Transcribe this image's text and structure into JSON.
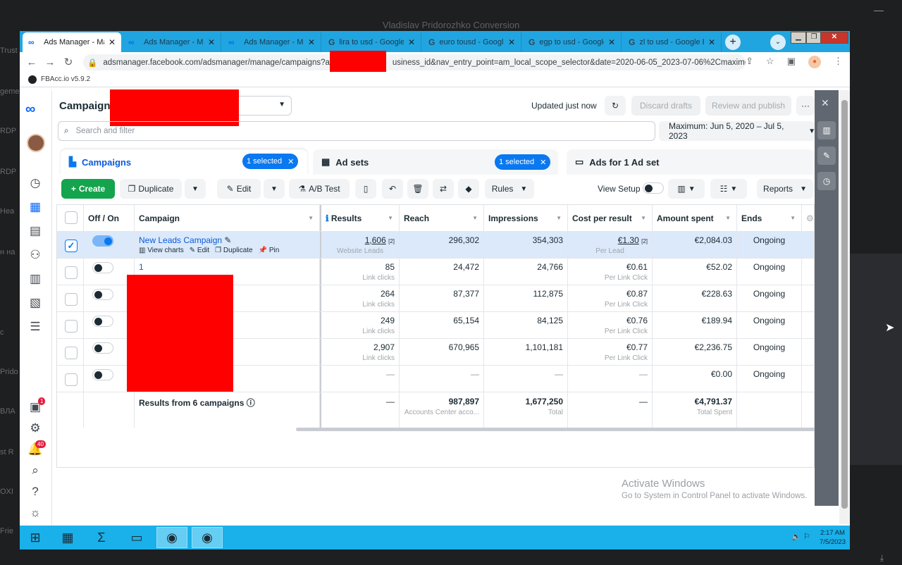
{
  "outer": {
    "title": "Vladislav Pridorozhko Conversion",
    "side_texts": [
      "Trust",
      "geme",
      "RDP",
      "RDP",
      "Hea",
      "н на",
      "c",
      "Prido",
      "ВЛА",
      "st R",
      "OXI",
      "Frie"
    ]
  },
  "browser": {
    "tabs": [
      {
        "label": "Ads Manager - Mar",
        "icon": "meta-icon"
      },
      {
        "label": "Ads Manager - Mar",
        "icon": "meta-icon"
      },
      {
        "label": "Ads Manager - Mar",
        "icon": "meta-icon"
      },
      {
        "label": "lira to usd - Google",
        "icon": "google-icon"
      },
      {
        "label": "euro tousd - Google",
        "icon": "google-icon"
      },
      {
        "label": "egp to usd - Google",
        "icon": "google-icon"
      },
      {
        "label": "zl to usd - Google B",
        "icon": "google-icon"
      }
    ],
    "url": "adsmanager.facebook.com/adsmanager/manage/campaigns?act",
    "url_tail": "usiness_id&nav_entry_point=am_local_scope_selector&date=2020-06-05_2023-07-06%2Cmaximu...",
    "extension": "FBAcc.io v5.9.2"
  },
  "header": {
    "title": "Campaigns",
    "updated": "Updated just now",
    "discard": "Discard drafts",
    "review": "Review and publish",
    "more": "···",
    "search_placeholder": "Search and filter",
    "date_range": "Maximum: Jun 5, 2020 – Jul 5, 2023"
  },
  "level_tabs": {
    "campaigns": "Campaigns",
    "campaigns_chip": "1 selected",
    "adsets": "Ad sets",
    "adsets_chip": "1 selected",
    "ads": "Ads for 1 Ad set"
  },
  "actions": {
    "create": "Create",
    "duplicate": "Duplicate",
    "edit": "Edit",
    "abtest": "A/B Test",
    "rules": "Rules",
    "view_setup": "View Setup",
    "reports": "Reports"
  },
  "table": {
    "columns": {
      "offon": "Off / On",
      "campaign": "Campaign",
      "results": "Results",
      "reach": "Reach",
      "impressions": "Impressions",
      "cpr": "Cost per result",
      "spent": "Amount spent",
      "ends": "Ends"
    },
    "hover_links": {
      "charts": "View charts",
      "edit": "Edit",
      "duplicate": "Duplicate",
      "pin": "Pin"
    },
    "rows": [
      {
        "name": "New Leads Campaign",
        "on": true,
        "selected": true,
        "results": "1,606",
        "results_sub": "Website Leads",
        "reach": "296,302",
        "impressions": "354,303",
        "cpr": "€1.30",
        "cpr_sub": "Per Lead",
        "spent": "€2,084.03",
        "ends": "Ongoing"
      },
      {
        "name": "1",
        "on": false,
        "selected": false,
        "results": "85",
        "results_sub": "Link clicks",
        "reach": "24,472",
        "impressions": "24,766",
        "cpr": "€0.61",
        "cpr_sub": "Per Link Click",
        "spent": "€52.02",
        "ends": "Ongoing"
      },
      {
        "name": "",
        "on": false,
        "selected": false,
        "results": "264",
        "results_sub": "Link clicks",
        "reach": "87,377",
        "impressions": "112,875",
        "cpr": "€0.87",
        "cpr_sub": "Per Link Click",
        "spent": "€228.63",
        "ends": "Ongoing"
      },
      {
        "name": "",
        "on": false,
        "selected": false,
        "results": "249",
        "results_sub": "Link clicks",
        "reach": "65,154",
        "impressions": "84,125",
        "cpr": "€0.76",
        "cpr_sub": "Per Link Click",
        "spent": "€189.94",
        "ends": "Ongoing"
      },
      {
        "name": "",
        "on": false,
        "selected": false,
        "results": "2,907",
        "results_sub": "Link clicks",
        "reach": "670,965",
        "impressions": "1,101,181",
        "cpr": "€0.77",
        "cpr_sub": "Per Link Click",
        "spent": "€2,236.75",
        "ends": "Ongoing"
      },
      {
        "name": "",
        "on": false,
        "selected": false,
        "results": "—",
        "results_sub": "",
        "reach": "—",
        "impressions": "—",
        "cpr": "—",
        "cpr_sub": "",
        "spent": "€0.00",
        "ends": "Ongoing"
      }
    ],
    "total": {
      "label": "Results from 6 campaigns",
      "results": "—",
      "reach": "987,897",
      "reach_sub": "Accounts Center acco...",
      "impressions": "1,677,250",
      "impressions_sub": "Total",
      "cpr": "—",
      "spent": "€4,791.37",
      "spent_sub": "Total Spent"
    }
  },
  "nav_badges": {
    "notices": "1",
    "alerts": "40"
  },
  "watermark": {
    "line1": "Activate Windows",
    "line2": "Go to System in Control Panel to activate Windows."
  },
  "taskbar": {
    "time": "2:17 AM",
    "date": "7/5/2023"
  },
  "colors": {
    "accent": "#0a78f0",
    "create": "#14a44d",
    "taskbar": "#1ab0ea",
    "tabstrip": "#21a5e0",
    "redaction": "#ff0000"
  }
}
